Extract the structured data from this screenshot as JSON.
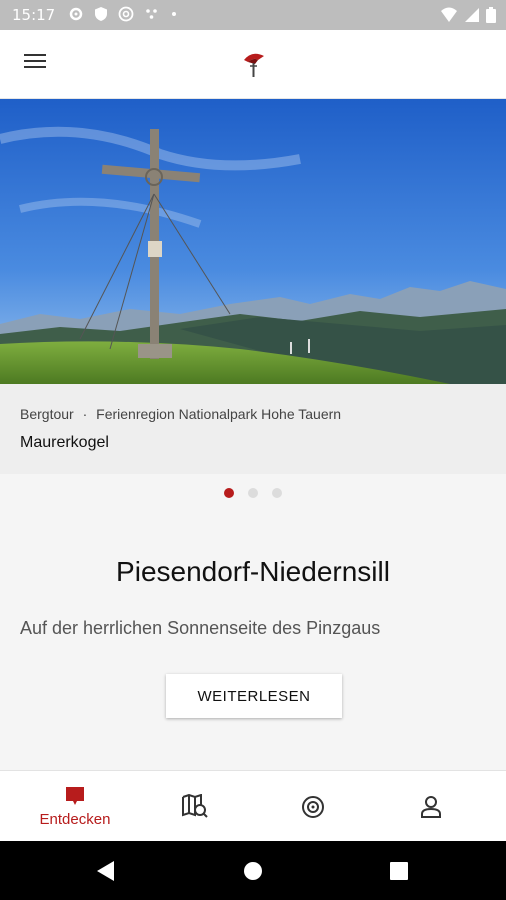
{
  "status_bar": {
    "time": "15:17"
  },
  "hero": {
    "category": "Bergtour",
    "region": "Ferienregion Nationalpark Hohe Tauern",
    "separator": "·",
    "title": "Maurerkogel"
  },
  "carousel": {
    "count": 3,
    "active": 0
  },
  "content": {
    "title": "Piesendorf-Niedernsill",
    "subtitle": "Auf der herrlichen Sonnenseite des Pinzgaus",
    "read_more_label": "WEITERLESEN"
  },
  "bottom_nav": {
    "items": [
      {
        "label": "Entdecken",
        "icon": "discover-icon",
        "active": true
      },
      {
        "label": "",
        "icon": "map-search-icon",
        "active": false
      },
      {
        "label": "",
        "icon": "target-icon",
        "active": false
      },
      {
        "label": "",
        "icon": "profile-icon",
        "active": false
      }
    ]
  },
  "colors": {
    "accent": "#b71c1c",
    "status_bar": "#bdbdbd",
    "sys_nav": "#000000"
  }
}
